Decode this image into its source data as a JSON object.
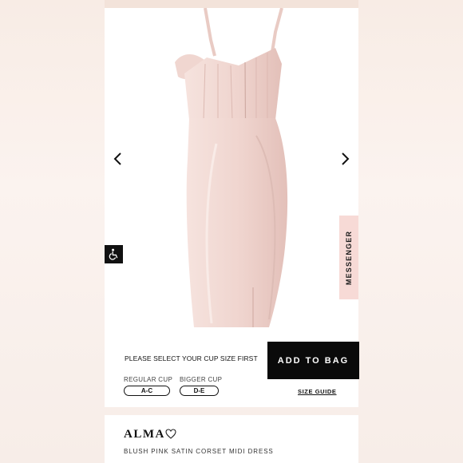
{
  "product": {
    "name": "ALMA",
    "description": "BLUSH PINK SATIN CORSET MIDI DRESS",
    "colors": {
      "dress": "#f1d9d3",
      "dress_shadow": "#e2c2bb"
    }
  },
  "purchase": {
    "cup_prompt": "PLEASE SELECT YOUR CUP SIZE FIRST",
    "add_to_bag": "ADD TO BAG",
    "regular_cup_label": "REGULAR CUP",
    "regular_cup_option": "A-C",
    "bigger_cup_label": "BIGGER CUP",
    "bigger_cup_option": "D-E",
    "size_guide": "SIZE GUIDE"
  },
  "widgets": {
    "messenger": "MESSENGER",
    "accessibility_icon": "wheelchair-icon"
  }
}
